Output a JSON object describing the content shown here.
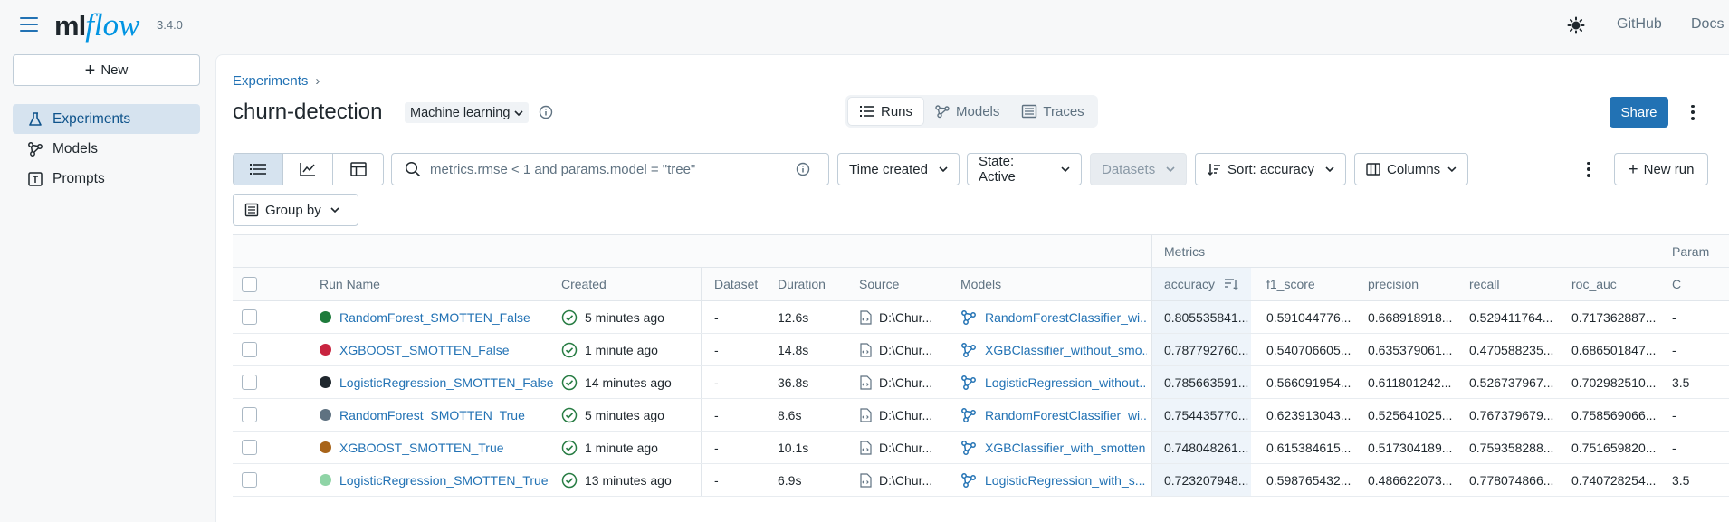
{
  "app": {
    "logo_ml": "ml",
    "logo_flow": "flow",
    "version": "3.4.0"
  },
  "top_nav": {
    "github": "GitHub",
    "docs": "Docs"
  },
  "sidebar": {
    "new_label": "New",
    "items": [
      {
        "label": "Experiments",
        "icon": "beaker-icon",
        "active": true
      },
      {
        "label": "Models",
        "icon": "models-icon",
        "active": false
      },
      {
        "label": "Prompts",
        "icon": "prompt-icon",
        "active": false
      }
    ]
  },
  "header": {
    "breadcrumb": "Experiments",
    "title": "churn-detection",
    "type_label": "Machine learning",
    "tabs": [
      "Runs",
      "Models",
      "Traces"
    ],
    "share_label": "Share"
  },
  "toolbar": {
    "search_placeholder": "metrics.rmse < 1 and params.model = \"tree\"",
    "time_created": "Time created",
    "state": "State: Active",
    "datasets": "Datasets",
    "sort": "Sort: accuracy",
    "columns": "Columns",
    "new_run": "New run",
    "group_by": "Group by"
  },
  "table": {
    "group_headers": {
      "metrics": "Metrics",
      "params": "Param"
    },
    "columns": {
      "run_name": "Run Name",
      "created": "Created",
      "dataset": "Dataset",
      "duration": "Duration",
      "source": "Source",
      "models": "Models",
      "accuracy": "accuracy",
      "f1_score": "f1_score",
      "precision": "precision",
      "recall": "recall",
      "roc_auc": "roc_auc",
      "param_c": "C"
    },
    "rows": [
      {
        "name": "RandomForest_SMOTTEN_False",
        "color": "#1e7b3c",
        "created": "5 minutes ago",
        "dataset": "-",
        "duration": "12.6s",
        "source": "D:\\Chur...",
        "model": "RandomForestClassifier_wi...",
        "accuracy": "0.805535841...",
        "f1": "0.591044776...",
        "precision": "0.668918918...",
        "recall": "0.529411764...",
        "roc_auc": "0.717362887...",
        "c": "-"
      },
      {
        "name": "XGBOOST_SMOTTEN_False",
        "color": "#c8243f",
        "created": "1 minute ago",
        "dataset": "-",
        "duration": "14.8s",
        "source": "D:\\Chur...",
        "model": "XGBClassifier_without_smo...",
        "accuracy": "0.787792760...",
        "f1": "0.540706605...",
        "precision": "0.635379061...",
        "recall": "0.470588235...",
        "roc_auc": "0.686501847...",
        "c": "-"
      },
      {
        "name": "LogisticRegression_SMOTTEN_False",
        "color": "#1f272d",
        "created": "14 minutes ago",
        "dataset": "-",
        "duration": "36.8s",
        "source": "D:\\Chur...",
        "model": "LogisticRegression_without...",
        "accuracy": "0.785663591...",
        "f1": "0.566091954...",
        "precision": "0.611801242...",
        "recall": "0.526737967...",
        "roc_auc": "0.702982510...",
        "c": "3.5"
      },
      {
        "name": "RandomForest_SMOTTEN_True",
        "color": "#5f7281",
        "created": "5 minutes ago",
        "dataset": "-",
        "duration": "8.6s",
        "source": "D:\\Chur...",
        "model": "RandomForestClassifier_wi...",
        "accuracy": "0.754435770...",
        "f1": "0.623913043...",
        "precision": "0.525641025...",
        "recall": "0.767379679...",
        "roc_auc": "0.758569066...",
        "c": "-"
      },
      {
        "name": "XGBOOST_SMOTTEN_True",
        "color": "#a8641a",
        "created": "1 minute ago",
        "dataset": "-",
        "duration": "10.1s",
        "source": "D:\\Chur...",
        "model": "XGBClassifier_with_smotten",
        "accuracy": "0.748048261...",
        "f1": "0.615384615...",
        "precision": "0.517304189...",
        "recall": "0.759358288...",
        "roc_auc": "0.751659820...",
        "c": "-"
      },
      {
        "name": "LogisticRegression_SMOTTEN_True",
        "color": "#8fd4a6",
        "created": "13 minutes ago",
        "dataset": "-",
        "duration": "6.9s",
        "source": "D:\\Chur...",
        "model": "LogisticRegression_with_s...",
        "accuracy": "0.723207948...",
        "f1": "0.598765432...",
        "precision": "0.486622073...",
        "recall": "0.778074866...",
        "roc_auc": "0.740728254...",
        "c": "3.5"
      }
    ]
  }
}
